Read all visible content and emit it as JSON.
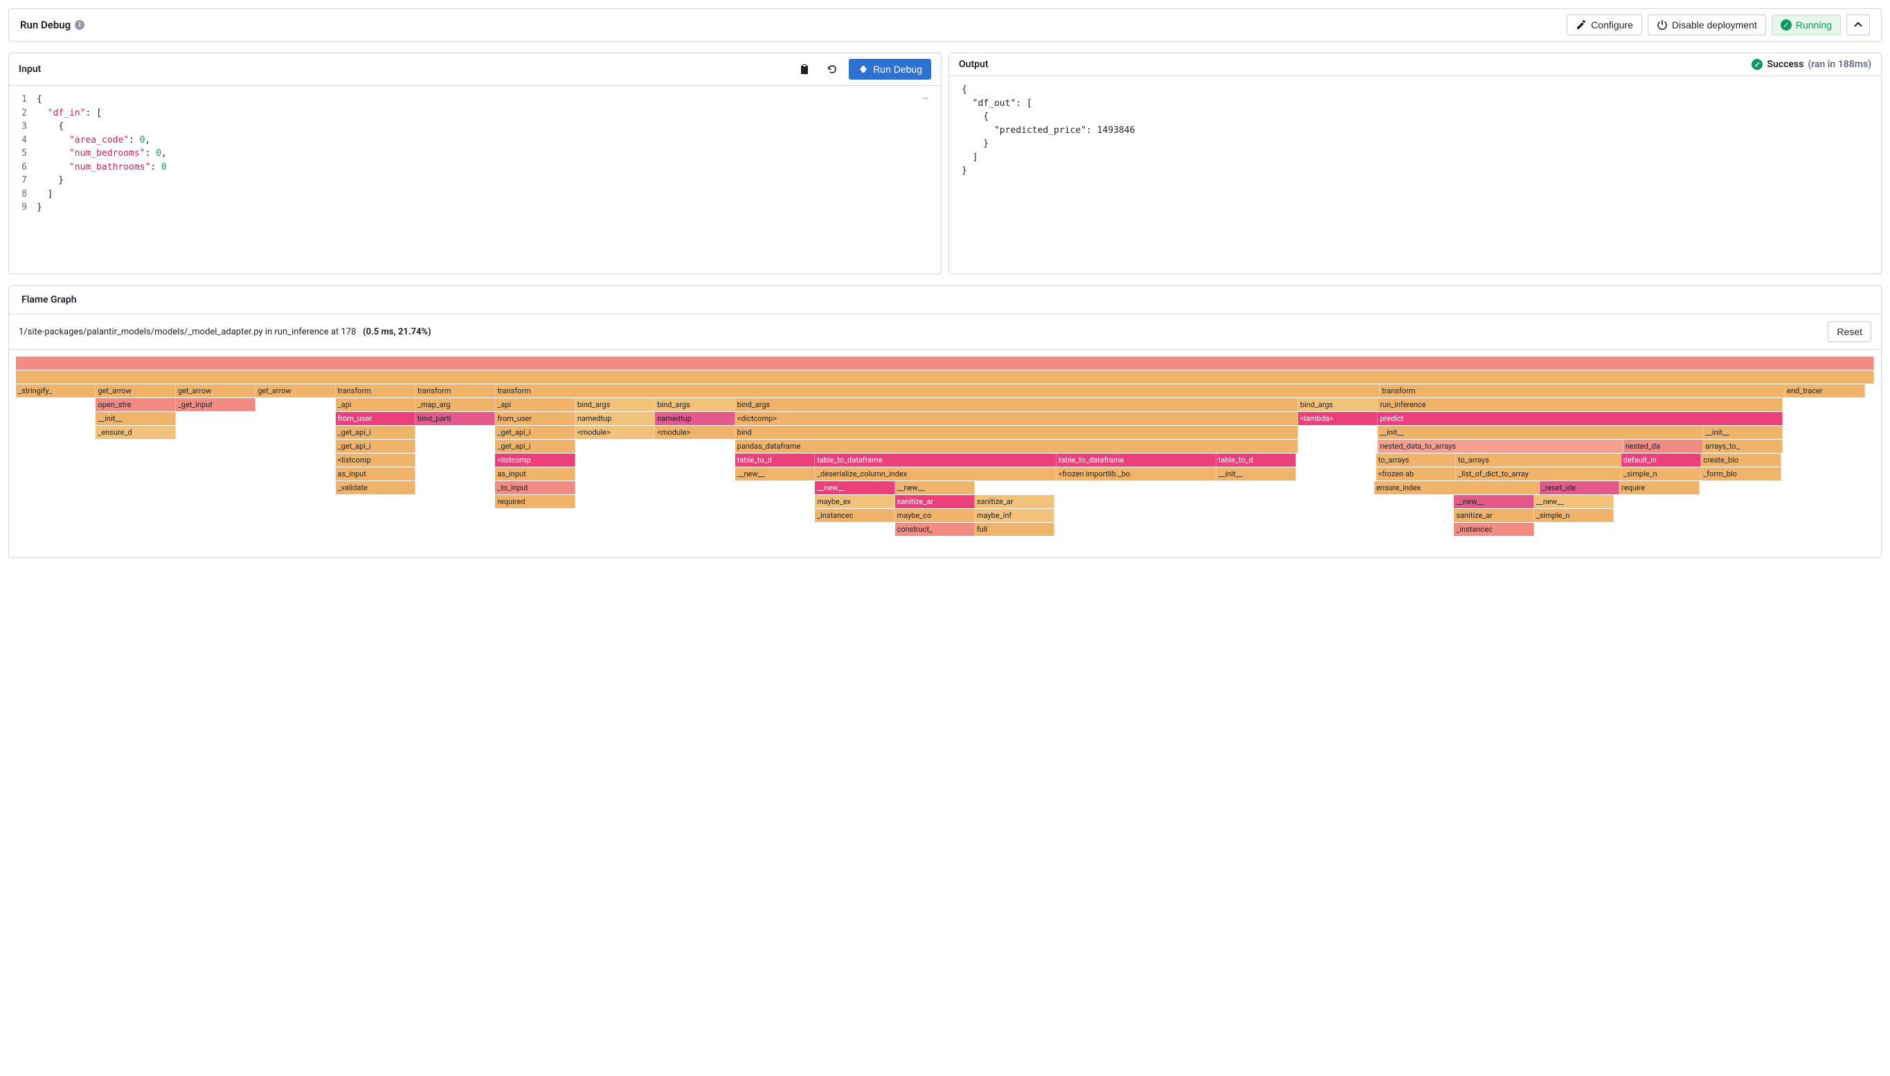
{
  "header": {
    "title": "Run Debug",
    "configure": "Configure",
    "disable": "Disable deployment",
    "running": "Running"
  },
  "input": {
    "title": "Input",
    "run_label": "Run Debug",
    "lines": {
      "l1": "{",
      "l2a": "  \"df_in\"",
      "l2b": ": [",
      "l3": "    {",
      "l4a": "      \"area_code\"",
      "l4b": ": ",
      "l4c": "0",
      "l4d": ",",
      "l5a": "      \"num_bedrooms\"",
      "l5b": ": ",
      "l5c": "0",
      "l5d": ",",
      "l6a": "      \"num_bathrooms\"",
      "l6b": ": ",
      "l6c": "0",
      "l7": "    }",
      "l8": "  ]",
      "l9": "}"
    }
  },
  "output": {
    "title": "Output",
    "status": "Success",
    "timing": "(ran in 188ms)",
    "body": "{\n  \"df_out\": [\n    {\n      \"predicted_price\": 1493846\n    }\n  ]\n}"
  },
  "flame": {
    "title": "Flame Graph",
    "path": "1/site-packages/palantir_models/models/_model_adapter.py in run_inference at 178",
    "stats": "(0.5 ms, 21.74%)",
    "reset": "Reset",
    "rows": [
      [
        {
          "w": 100,
          "c": "c-sal",
          "t": ""
        }
      ],
      [
        {
          "w": 100,
          "c": "c-or2",
          "t": ""
        }
      ],
      [
        {
          "w": 4.3,
          "c": "c-or2",
          "t": "_stringify_"
        },
        {
          "w": 4.3,
          "c": "c-or2",
          "t": "get_arrow"
        },
        {
          "w": 4.3,
          "c": "c-or2",
          "t": "get_arrow"
        },
        {
          "w": 4.3,
          "c": "c-or2",
          "t": "get_arrow"
        },
        {
          "w": 4.3,
          "c": "c-or2",
          "t": "transform"
        },
        {
          "w": 4.3,
          "c": "c-or2",
          "t": "transform"
        },
        {
          "w": 47.6,
          "c": "c-or2",
          "t": "transform"
        },
        {
          "w": 21.8,
          "c": "c-or2",
          "t": "transform"
        },
        {
          "w": 4.3,
          "c": "c-or2",
          "t": "end_tracer"
        }
      ],
      [
        {
          "w": 4.3,
          "c": "gap",
          "t": ""
        },
        {
          "w": 4.3,
          "c": "c-sal",
          "t": "open_stre"
        },
        {
          "w": 4.3,
          "c": "c-sal",
          "t": "_get_input"
        },
        {
          "w": 4.3,
          "c": "gap",
          "t": ""
        },
        {
          "w": 4.3,
          "c": "c-or2",
          "t": "_api"
        },
        {
          "w": 4.3,
          "c": "c-or2",
          "t": "_map_arg"
        },
        {
          "w": 4.3,
          "c": "c-or2",
          "t": "_api"
        },
        {
          "w": 4.3,
          "c": "c-or3",
          "t": "bind_args"
        },
        {
          "w": 4.3,
          "c": "c-or3",
          "t": "bind_args"
        },
        {
          "w": 30.3,
          "c": "c-or2",
          "t": "bind_args"
        },
        {
          "w": 4.3,
          "c": "c-or3",
          "t": "bind_args"
        },
        {
          "w": 21.8,
          "c": "c-or2",
          "t": "run_inference"
        }
      ],
      [
        {
          "w": 4.3,
          "c": "gap",
          "t": ""
        },
        {
          "w": 4.3,
          "c": "c-or2",
          "t": "__init__"
        },
        {
          "w": 8.6,
          "c": "gap",
          "t": ""
        },
        {
          "w": 4.3,
          "c": "c-pk1",
          "t": "from_user"
        },
        {
          "w": 4.3,
          "c": "c-pk2",
          "t": "bind_parti"
        },
        {
          "w": 4.3,
          "c": "c-or2",
          "t": "from_user"
        },
        {
          "w": 4.3,
          "c": "c-or3",
          "t": "namedtup"
        },
        {
          "w": 4.3,
          "c": "c-pk2",
          "t": "namedtup"
        },
        {
          "w": 30.3,
          "c": "c-or2",
          "t": "<dictcomp>"
        },
        {
          "w": 4.3,
          "c": "c-pk1",
          "t": "<lambda>"
        },
        {
          "w": 21.8,
          "c": "c-pk1",
          "t": "predict"
        }
      ],
      [
        {
          "w": 4.3,
          "c": "gap",
          "t": ""
        },
        {
          "w": 4.3,
          "c": "c-or3",
          "t": "_ensure_d"
        },
        {
          "w": 8.6,
          "c": "gap",
          "t": ""
        },
        {
          "w": 4.3,
          "c": "c-or2",
          "t": "_get_api_i"
        },
        {
          "w": 4.3,
          "c": "gap",
          "t": ""
        },
        {
          "w": 4.3,
          "c": "c-or2",
          "t": "_get_api_i"
        },
        {
          "w": 4.3,
          "c": "c-or3",
          "t": "<module>"
        },
        {
          "w": 4.3,
          "c": "c-or2",
          "t": "<module>"
        },
        {
          "w": 30.3,
          "c": "c-or2",
          "t": "bind"
        },
        {
          "w": 4.3,
          "c": "gap",
          "t": ""
        },
        {
          "w": 17.5,
          "c": "c-or2",
          "t": "__init__"
        },
        {
          "w": 4.3,
          "c": "c-or2",
          "t": "__init__"
        }
      ],
      [
        {
          "w": 17.2,
          "c": "gap",
          "t": ""
        },
        {
          "w": 4.3,
          "c": "c-or2",
          "t": "_get_api_i"
        },
        {
          "w": 4.3,
          "c": "gap",
          "t": ""
        },
        {
          "w": 4.3,
          "c": "c-or2",
          "t": "_get_api_i"
        },
        {
          "w": 8.6,
          "c": "gap",
          "t": ""
        },
        {
          "w": 30.3,
          "c": "c-or2",
          "t": "pandas_dataframe"
        },
        {
          "w": 4.3,
          "c": "gap",
          "t": ""
        },
        {
          "w": 13.2,
          "c": "c-sal2",
          "t": "nested_data_to_arrays"
        },
        {
          "w": 4.3,
          "c": "c-sal",
          "t": "nested_da"
        },
        {
          "w": 4.3,
          "c": "c-or2",
          "t": "arrays_to_"
        }
      ],
      [
        {
          "w": 17.2,
          "c": "gap",
          "t": ""
        },
        {
          "w": 4.3,
          "c": "c-or2",
          "t": "<listcomp"
        },
        {
          "w": 4.3,
          "c": "gap",
          "t": ""
        },
        {
          "w": 4.3,
          "c": "c-pk1",
          "t": "<listcomp"
        },
        {
          "w": 8.6,
          "c": "gap",
          "t": ""
        },
        {
          "w": 4.3,
          "c": "c-pk1",
          "t": "table_to_d"
        },
        {
          "w": 13.0,
          "c": "c-pk1",
          "t": "table_to_dataframe"
        },
        {
          "w": 8.6,
          "c": "c-pk1",
          "t": "table_to_dataframe"
        },
        {
          "w": 4.3,
          "c": "c-pk1",
          "t": "table_to_d"
        },
        {
          "w": 4.3,
          "c": "gap",
          "t": ""
        },
        {
          "w": 4.3,
          "c": "c-or2",
          "t": "to_arrays"
        },
        {
          "w": 8.9,
          "c": "c-or2",
          "t": "to_arrays"
        },
        {
          "w": 4.3,
          "c": "c-pk1",
          "t": "default_in"
        },
        {
          "w": 4.3,
          "c": "c-or2",
          "t": "create_blo"
        }
      ],
      [
        {
          "w": 17.2,
          "c": "gap",
          "t": ""
        },
        {
          "w": 4.3,
          "c": "c-or2",
          "t": "as_input"
        },
        {
          "w": 4.3,
          "c": "gap",
          "t": ""
        },
        {
          "w": 4.3,
          "c": "c-or2",
          "t": "as_input"
        },
        {
          "w": 8.6,
          "c": "gap",
          "t": ""
        },
        {
          "w": 4.3,
          "c": "c-or2",
          "t": "__new__"
        },
        {
          "w": 13.0,
          "c": "c-or2",
          "t": "_deserialize_column_index"
        },
        {
          "w": 8.6,
          "c": "c-or2",
          "t": "<frozen importlib._bo"
        },
        {
          "w": 4.3,
          "c": "c-or2",
          "t": "__init__"
        },
        {
          "w": 4.3,
          "c": "gap",
          "t": ""
        },
        {
          "w": 4.3,
          "c": "c-or2",
          "t": "<frozen ab"
        },
        {
          "w": 8.9,
          "c": "c-or2",
          "t": "_list_of_dict_to_array"
        },
        {
          "w": 4.3,
          "c": "c-or2",
          "t": "_simple_n"
        },
        {
          "w": 4.3,
          "c": "c-or2",
          "t": "_form_blo"
        }
      ],
      [
        {
          "w": 17.2,
          "c": "gap",
          "t": ""
        },
        {
          "w": 4.3,
          "c": "c-or2",
          "t": "_validate"
        },
        {
          "w": 4.3,
          "c": "gap",
          "t": ""
        },
        {
          "w": 4.3,
          "c": "c-sal",
          "t": "_to_input"
        },
        {
          "w": 12.9,
          "c": "gap",
          "t": ""
        },
        {
          "w": 4.3,
          "c": "c-pk1",
          "t": "__new__"
        },
        {
          "w": 4.3,
          "c": "c-or2",
          "t": "__new__"
        },
        {
          "w": 21.5,
          "c": "gap",
          "t": ""
        },
        {
          "w": 8.9,
          "c": "c-or2",
          "t": "ensure_index"
        },
        {
          "w": 4.3,
          "c": "c-pk2",
          "t": "_reset_ide"
        },
        {
          "w": 4.3,
          "c": "c-or2",
          "t": "require"
        }
      ],
      [
        {
          "w": 25.8,
          "c": "gap",
          "t": ""
        },
        {
          "w": 4.3,
          "c": "c-or2",
          "t": "required"
        },
        {
          "w": 12.9,
          "c": "gap",
          "t": ""
        },
        {
          "w": 4.3,
          "c": "c-or3",
          "t": "maybe_ex"
        },
        {
          "w": 4.3,
          "c": "c-pk1",
          "t": "sanitize_ar"
        },
        {
          "w": 4.3,
          "c": "c-or3",
          "t": "sanitize_ar"
        },
        {
          "w": 21.5,
          "c": "gap",
          "t": ""
        },
        {
          "w": 4.3,
          "c": "c-pk2",
          "t": "__new__"
        },
        {
          "w": 4.3,
          "c": "c-or3",
          "t": "__new__"
        }
      ],
      [
        {
          "w": 43.0,
          "c": "gap",
          "t": ""
        },
        {
          "w": 4.3,
          "c": "c-or2",
          "t": "_instancec"
        },
        {
          "w": 4.3,
          "c": "c-or2",
          "t": "maybe_co"
        },
        {
          "w": 4.3,
          "c": "c-or3",
          "t": "maybe_inf"
        },
        {
          "w": 21.5,
          "c": "gap",
          "t": ""
        },
        {
          "w": 4.3,
          "c": "c-or2",
          "t": "sanitize_ar"
        },
        {
          "w": 4.3,
          "c": "c-or2",
          "t": "_simple_n"
        }
      ],
      [
        {
          "w": 47.3,
          "c": "gap",
          "t": ""
        },
        {
          "w": 4.3,
          "c": "c-sal",
          "t": "construct_"
        },
        {
          "w": 4.3,
          "c": "c-or2",
          "t": "full"
        },
        {
          "w": 21.5,
          "c": "gap",
          "t": ""
        },
        {
          "w": 4.3,
          "c": "c-sal",
          "t": "_instancec"
        }
      ]
    ]
  }
}
